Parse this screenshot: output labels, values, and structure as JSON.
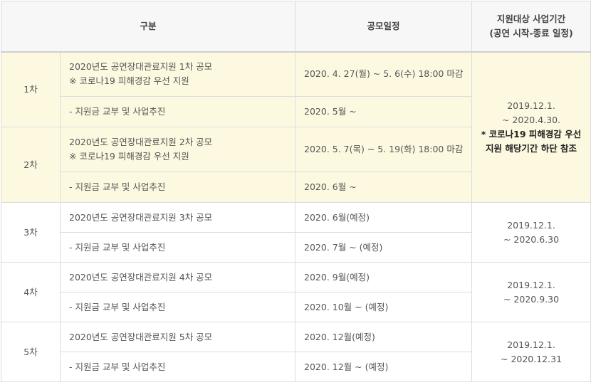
{
  "header": {
    "col_category": "구분",
    "col_schedule": "공모일정",
    "col_period_line1": "지원대상 사업기간",
    "col_period_line2": "(공연 시작-종료 일정)"
  },
  "rounds": [
    {
      "label": "1차",
      "announce_line1": "2020년도 공연장대관료지원 1차 공모",
      "announce_line2": "※ 코로나19 피해경감 우선 지원",
      "announce_date": "2020. 4. 27(월)  ~  5. 6(수) 18:00 마감",
      "grant_text": "- 지원금 교부 및 사업추진",
      "grant_date": "2020. 5월 ~"
    },
    {
      "label": "2차",
      "announce_line1": "2020년도 공연장대관료지원 2차 공모",
      "announce_line2": "※ 코로나19 피해경감 우선 지원",
      "announce_date": "2020. 5. 7(목)  ~  5. 19(화) 18:00 마감",
      "grant_text": "- 지원금 교부 및 사업추진",
      "grant_date": "2020. 6월 ~"
    },
    {
      "label": "3차",
      "announce_line1": "2020년도 공연장대관료지원 3차 공모",
      "announce_date": "2020. 6월(예정)",
      "grant_text": "- 지원금 교부 및 사업추진",
      "grant_date": "2020. 7월 ~ (예정)"
    },
    {
      "label": "4차",
      "announce_line1": "2020년도 공연장대관료지원 4차 공모",
      "announce_date": "2020. 9월(예정)",
      "grant_text": "- 지원금 교부 및 사업추진",
      "grant_date": "2020. 10월 ~ (예정)"
    },
    {
      "label": "5차",
      "announce_line1": "2020년도 공연장대관료지원 5차 공모",
      "announce_date": "2020. 12월(예정)",
      "grant_text": "- 지원금 교부 및 사업추진",
      "grant_date": "2020. 12월 ~ (예정)"
    }
  ],
  "periods": {
    "p12": {
      "line1": "2019.12.1.",
      "line2": "~ 2020.4.30.",
      "note1": "* 코로나19 피해경감 우선",
      "note2": "지원 해당기간 하단 참조"
    },
    "p3": {
      "line1": "2019.12.1.",
      "line2": "~ 2020.6.30"
    },
    "p4": {
      "line1": "2019.12.1.",
      "line2": "~ 2020.9.30"
    },
    "p5": {
      "line1": "2019.12.1.",
      "line2": "~ 2020.12.31"
    }
  },
  "colors": {
    "highlight": "#fdf9e1",
    "header_bg": "#f7f7f7",
    "border": "#dcdcdc"
  }
}
